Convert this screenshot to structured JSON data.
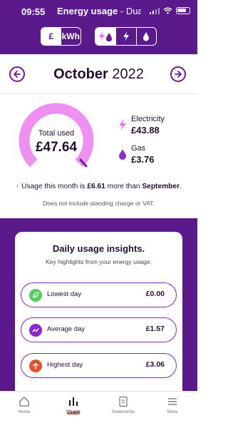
{
  "status_bar": {
    "time": "09:55"
  },
  "header": {
    "title_bold": "Energy usage",
    "title_light": " - Dual",
    "unit_toggle": [
      {
        "label": "£",
        "selected": true
      },
      {
        "label": "kWh",
        "selected": false
      }
    ],
    "fuel_toggle": [
      {
        "icon": "dual-fuel-icon",
        "selected": true
      },
      {
        "icon": "electricity-icon",
        "selected": false
      },
      {
        "icon": "gas-icon",
        "selected": false
      }
    ]
  },
  "period": {
    "month": "October",
    "year": " 2022",
    "prev_icon": "arrow-left-icon",
    "next_icon": "arrow-right-icon"
  },
  "summary": {
    "total_label": "Total used",
    "total_value": "£47.64",
    "electricity": {
      "label": "Electricity",
      "value": "£43.88",
      "color": "#ee6ff4"
    },
    "gas": {
      "label": "Gas",
      "value": "£3.76",
      "color": "#8b2fd1"
    },
    "comparison": {
      "prefix": "Usage this month is ",
      "amount": "£6.61",
      "middle": " more than ",
      "month": "September",
      "suffix": "."
    },
    "disclaimer": "Does not include standing charge or VAT."
  },
  "insights": {
    "title": "Daily usage insights.",
    "subtitle": "Key highlights from your energy usage.",
    "rows": [
      {
        "label": "Lowest day",
        "value": "£0.00",
        "icon": "leaf-icon",
        "color": "#5ac85a"
      },
      {
        "label": "Average day",
        "value": "£1.57",
        "icon": "trend-icon",
        "color": "#8a25d8"
      },
      {
        "label": "Highest day",
        "value": "£3.06",
        "icon": "arrow-up-icon",
        "color": "#e8502c"
      }
    ]
  },
  "bottom_nav": [
    {
      "label": "Home",
      "icon": "home-icon",
      "active": false
    },
    {
      "label": "Usage",
      "icon": "bar-chart-icon",
      "active": true
    },
    {
      "label": "Statements",
      "icon": "document-icon",
      "active": false
    },
    {
      "label": "More",
      "icon": "menu-icon",
      "active": false
    }
  ],
  "colors": {
    "brand_purple": "#5b1a8c",
    "accent_orange": "#e8502c",
    "gauge_pink": "#ee8ff2"
  }
}
